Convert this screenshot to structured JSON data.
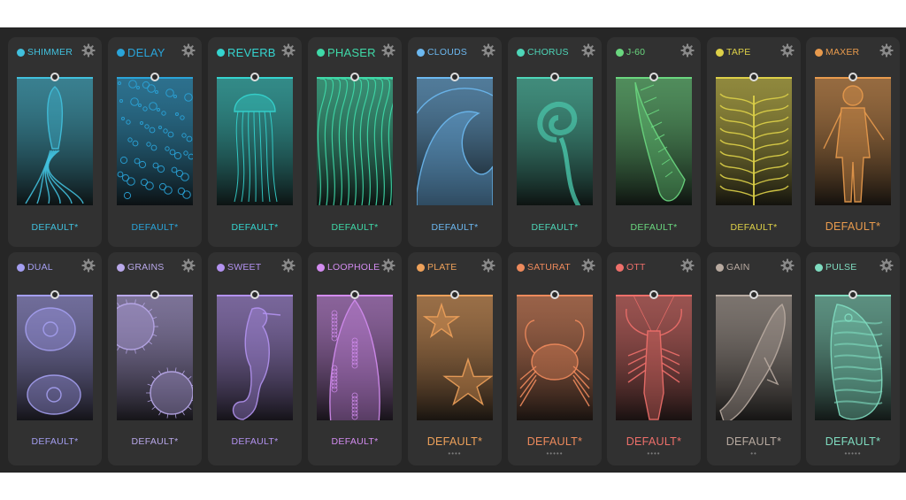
{
  "preset_label": "DEFAULT*",
  "cards": [
    {
      "name": "SHIMMER",
      "color": "#41c0dd",
      "creature": "squid-icon",
      "row": 1
    },
    {
      "name": "DELAY",
      "color": "#2aa4d9",
      "creature": "bubbles-icon",
      "row": 1
    },
    {
      "name": "REVERB",
      "color": "#35d4cf",
      "creature": "jellyfish-icon",
      "row": 1
    },
    {
      "name": "PHASER",
      "color": "#3fd9a8",
      "creature": "kelp-icon",
      "row": 1
    },
    {
      "name": "CLOUDS",
      "color": "#6cb8f0",
      "creature": "wave-icon",
      "row": 1
    },
    {
      "name": "CHORUS",
      "color": "#4ed6b8",
      "creature": "ammonite-icon",
      "row": 1
    },
    {
      "name": "J-60",
      "color": "#6ad77f",
      "creature": "conch-shell-icon",
      "row": 1
    },
    {
      "name": "TAPE",
      "color": "#ddd048",
      "creature": "seaweed-icon",
      "row": 1
    },
    {
      "name": "MAXER",
      "color": "#e89a4d",
      "creature": "diver-icon",
      "row": 1
    },
    {
      "name": "DUAL",
      "color": "#a49ef0",
      "creature": "moon-jelly-icon",
      "row": 2
    },
    {
      "name": "GRAINS",
      "color": "#b9a8ea",
      "creature": "urchin-icon",
      "row": 2
    },
    {
      "name": "SWEET",
      "color": "#b392f0",
      "creature": "seahorse-icon",
      "row": 2
    },
    {
      "name": "LOOPHOLE",
      "color": "#d38cf0",
      "creature": "eel-icon",
      "row": 2
    },
    {
      "name": "PLATE",
      "color": "#eea15a",
      "creature": "starfish-icon",
      "row": 2,
      "dots": "••••"
    },
    {
      "name": "SATURAT",
      "color": "#ee8a5c",
      "creature": "crab-icon",
      "row": 2,
      "dots": "•••••"
    },
    {
      "name": "OTT",
      "color": "#ee6f6a",
      "creature": "lobster-icon",
      "row": 2,
      "dots": "••••"
    },
    {
      "name": "GAIN",
      "color": "#b8aaa0",
      "creature": "dolphin-icon",
      "row": 2,
      "dots": "••"
    },
    {
      "name": "PULSE",
      "color": "#7fdcc0",
      "creature": "fish-icon",
      "row": 2,
      "dots": "•••••"
    }
  ]
}
